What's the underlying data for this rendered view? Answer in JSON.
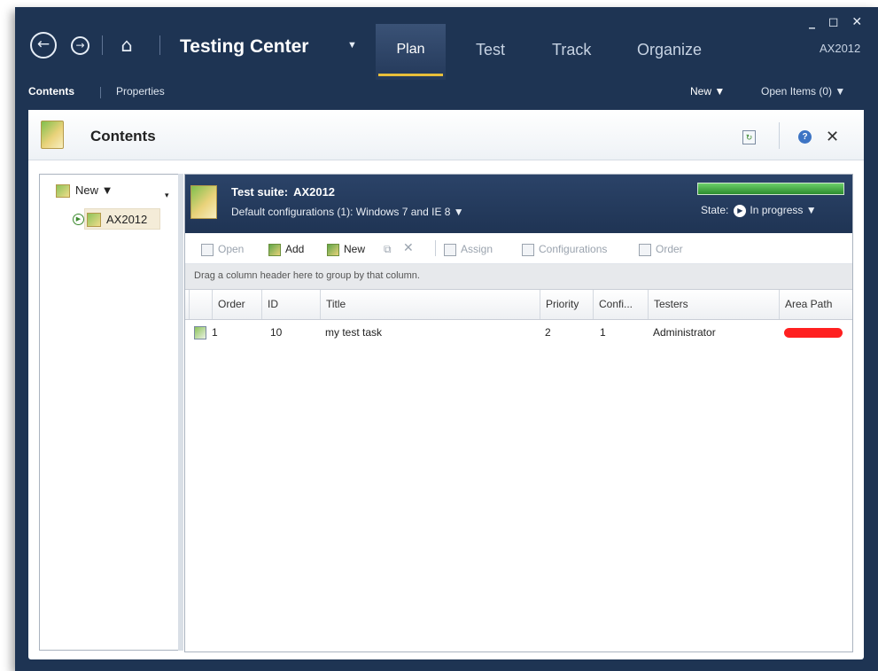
{
  "titlebar": {
    "app_title": "Testing Center",
    "tabs": [
      "Plan",
      "Test",
      "Track",
      "Organize"
    ],
    "active_tab": "Plan",
    "project": "AX2012",
    "window_controls": "_ ◻ ✕"
  },
  "subbar": {
    "contents": "Contents",
    "properties": "Properties",
    "new": "New ▼",
    "open_items": "Open Items (0) ▼"
  },
  "panel": {
    "title": "Contents"
  },
  "tree": {
    "new_label": "New",
    "items": [
      {
        "label": "AX2012"
      }
    ]
  },
  "suite": {
    "label": "Test suite:",
    "name": "AX2012",
    "configs": "Default configurations (1):  Windows 7 and IE 8 ▼",
    "state_label": "State:",
    "state_value": "In progress ▼",
    "progress": 1.0,
    "progress_color": "#3a9a3c"
  },
  "toolbar": {
    "open": "Open",
    "add": "Add",
    "new": "New",
    "assign": "Assign",
    "configurations": "Configurations",
    "order": "Order"
  },
  "grid": {
    "group_hint": "Drag a column header here to group by that column.",
    "columns": [
      "Order",
      "ID",
      "Title",
      "Priority",
      "Confi...",
      "Testers",
      "Area Path"
    ],
    "rows": [
      {
        "order": "1",
        "id": "10",
        "title": "my test task",
        "priority": "2",
        "configs": "1",
        "testers": "Administrator",
        "area_path": ""
      }
    ]
  },
  "colors": {
    "chrome": "#1e3453",
    "accent_underline": "#e8bf3a",
    "redaction": "#ff2020"
  }
}
